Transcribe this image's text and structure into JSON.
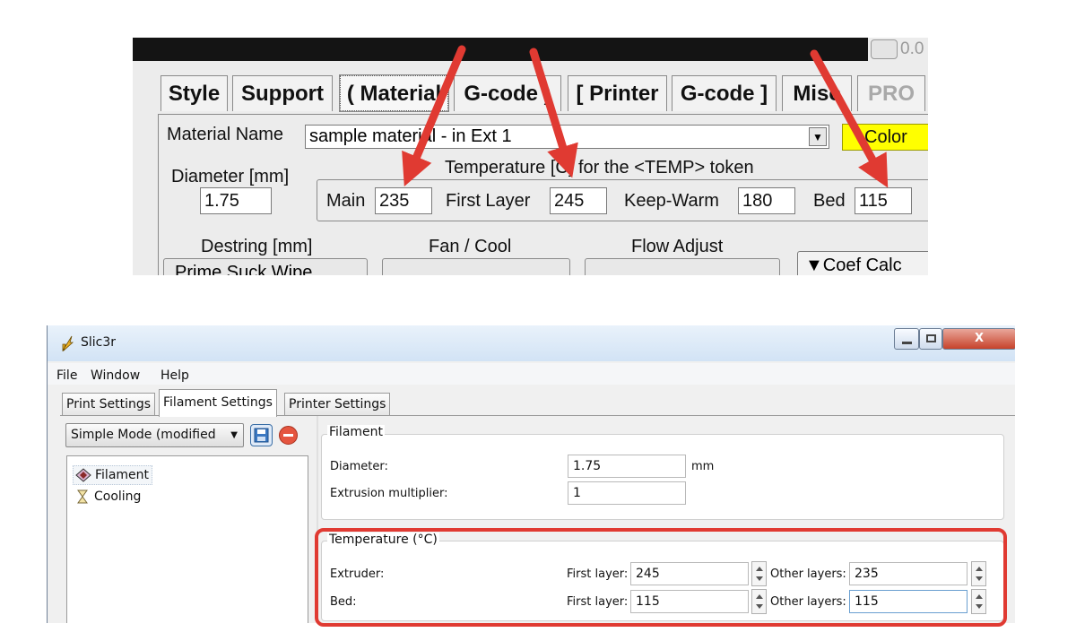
{
  "top_panel": {
    "corner_text": "0.0",
    "tabs": [
      {
        "label": "Style"
      },
      {
        "label": "Support"
      },
      {
        "label": "( Material"
      },
      {
        "label": "G-code )"
      },
      {
        "label": "[ Printer"
      },
      {
        "label": "G-code ]"
      },
      {
        "label": "Misc"
      },
      {
        "label": "PRO"
      }
    ],
    "material_name_label": "Material Name",
    "material_name_value": "sample material - in Ext 1",
    "color_button": "Color",
    "diameter_label": "Diameter [mm]",
    "diameter_value": "1.75",
    "temperature_title": "Temperature [C] for the <TEMP> token",
    "main_label": "Main",
    "main_value": "235",
    "first_layer_label": "First Layer",
    "first_layer_value": "245",
    "keep_warm_label": "Keep-Warm",
    "keep_warm_value": "180",
    "bed_label": "Bed",
    "bed_value": "115",
    "destring_label": "Destring [mm]",
    "fan_label": "Fan / Cool",
    "flow_label": "Flow Adjust",
    "coef_button": "▼Coef Calc",
    "destring_buttons_text": "Prime   Suck   Wipe"
  },
  "slic3r": {
    "window_title": "Slic3r",
    "close_glyph": "X",
    "menu": [
      "File",
      "Window",
      "Help"
    ],
    "tabs": [
      "Print Settings",
      "Filament Settings",
      "Printer Settings"
    ],
    "mode_select": "Simple Mode (modified",
    "tree": [
      "Filament",
      "Cooling"
    ],
    "filament_group": {
      "title": "Filament",
      "diameter_label": "Diameter:",
      "diameter_value": "1.75",
      "diameter_unit": "mm",
      "extrusion_label": "Extrusion multiplier:",
      "extrusion_value": "1"
    },
    "temperature_group": {
      "title": "Temperature (°C)",
      "extruder_label": "Extruder:",
      "bed_label": "Bed:",
      "first_layer_label": "First layer:",
      "other_layers_label": "Other layers:",
      "extruder_first": "245",
      "extruder_other": "235",
      "bed_first": "115",
      "bed_other": "115"
    }
  },
  "colors": {
    "arrow": "#e03a32",
    "highlight": "#e03a32",
    "color_button": "#ffff00"
  }
}
